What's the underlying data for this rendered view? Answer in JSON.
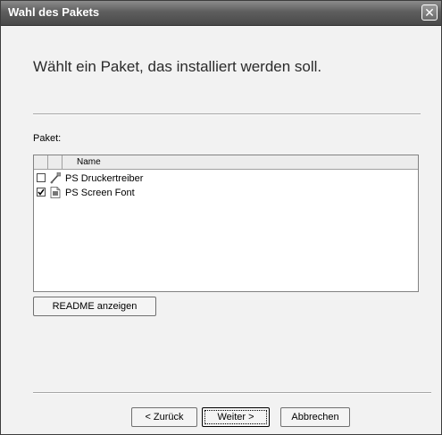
{
  "window": {
    "title": "Wahl des Pakets",
    "close_glyph": "✕"
  },
  "header": {
    "text": "Wählt ein Paket, das installiert werden soll."
  },
  "package_label": "Paket:",
  "list": {
    "column_header": "Name",
    "rows": [
      {
        "label": "PS Druckertreiber",
        "checked": false,
        "icon": "printer-driver-icon"
      },
      {
        "label": "PS Screen Font",
        "checked": true,
        "icon": "font-file-icon"
      }
    ]
  },
  "readme_button": "README anzeigen",
  "nav": {
    "back": "< Zurück",
    "next": "Weiter >",
    "cancel": "Abbrechen"
  }
}
